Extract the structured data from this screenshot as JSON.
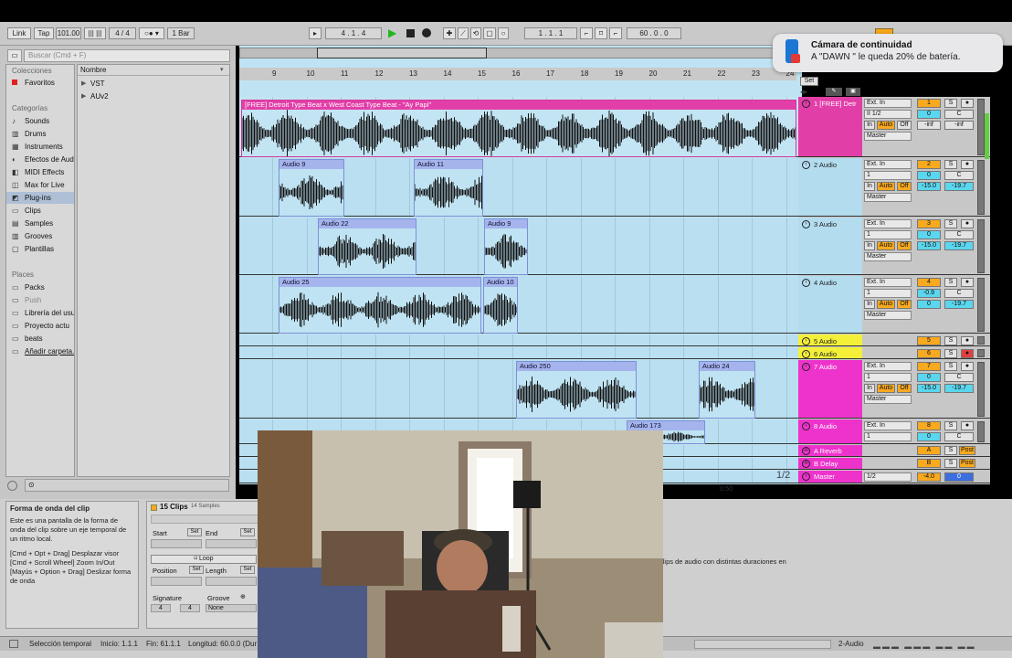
{
  "control_bar": {
    "link": "Link",
    "tap": "Tap",
    "tempo": "101.00",
    "signature": "4 / 4",
    "quantize": "1 Bar",
    "arrangement_position": "4 . 1 . 4",
    "punch_position": "1 . 1 . 1",
    "loop_length": "60 . 0 . 0"
  },
  "browser": {
    "search_placeholder": "Buscar (Cmd + F)",
    "collections_header": "Colecciones",
    "favorites": "Favoritos",
    "categories_header": "Categorías",
    "categories": [
      "Sounds",
      "Drums",
      "Instruments",
      "Efectos de Aud",
      "MIDI Effects",
      "Max for Live",
      "Plug-ins",
      "Clips",
      "Samples",
      "Grooves",
      "Plantillas"
    ],
    "selected_category": "Plug-ins",
    "places_header": "Places",
    "places": [
      "Packs",
      "Push",
      "Librería del usu",
      "Proyecto actu",
      "beats",
      "Añadir carpeta..."
    ],
    "column_header": "Nombre",
    "files": [
      "VST",
      "AUv2"
    ]
  },
  "ruler": {
    "bars": [
      "9",
      "10",
      "11",
      "12",
      "13",
      "14",
      "15",
      "16",
      "17",
      "18",
      "19",
      "20",
      "21",
      "22",
      "23",
      "24"
    ],
    "set_label": "Set"
  },
  "clips": {
    "track1": "[FREE] Detroit Type Beat x West Coast Type Beat - \"Ay Papi\"",
    "audio9a": "Audio 9",
    "audio11": "Audio 11",
    "audio22": "Audio 22",
    "audio9b": "Audio 9",
    "audio25": "Audio 25",
    "audio10": "Audio 10",
    "audio250": "Audio 250",
    "audio24": "Audio 24",
    "audio173": "Audio 173"
  },
  "tracks": [
    {
      "name": "1 [FREE] Detr",
      "input": "Ext. In",
      "channel": "II 1/2",
      "out": "Master",
      "number": "1",
      "vol": "0",
      "pan": "C",
      "peak1": "-inf",
      "peak2": "-inf"
    },
    {
      "name": "2 Audio",
      "input": "Ext. In",
      "channel": "1",
      "out": "Master",
      "number": "2",
      "vol": "0",
      "pan": "C",
      "peak1": "-15.0",
      "peak2": "-19.7"
    },
    {
      "name": "3 Audio",
      "input": "Ext. In",
      "channel": "1",
      "out": "Master",
      "number": "3",
      "vol": "0",
      "pan": "C",
      "peak1": "-15.0",
      "peak2": "-19.7"
    },
    {
      "name": "4 Audio",
      "input": "Ext. In",
      "channel": "1",
      "out": "Master",
      "number": "4",
      "vol": "-0.9",
      "pan": "C",
      "peak1": "0",
      "peak2": "-19.7"
    },
    {
      "name": "5 Audio",
      "number": "5"
    },
    {
      "name": "6 Audio",
      "number": "6"
    },
    {
      "name": "7 Audio",
      "input": "Ext. In",
      "channel": "1",
      "out": "Master",
      "number": "7",
      "vol": "0",
      "pan": "C",
      "peak1": "-15.0",
      "peak2": "-19.7"
    },
    {
      "name": "8 Audio",
      "input": "Ext. In",
      "channel": "1",
      "number": "8",
      "vol": "0",
      "pan": "C"
    }
  ],
  "returns": {
    "a_name": "A Reverb",
    "a_letter": "A",
    "b_name": "B Delay",
    "b_letter": "B",
    "master_name": "Master",
    "master_channel": "1/2",
    "master_vol": "-4.0",
    "master_pan": "0",
    "post": "Post",
    "page": "1/2",
    "time_marker": "0:50"
  },
  "mixer_labels": {
    "in": "In",
    "auto": "Auto",
    "off": "Off",
    "s": "S"
  },
  "info_pane": {
    "title": "Forma de onda del clip",
    "text1": "Este es una pantalla de la forma de onda del clip sobre un eje temporal de un ritmo local.",
    "text2": "[Cmd + Opt + Drag] Desplazar visor",
    "text3": "[Cmd + Scroll Wheel] Zoom In/Out",
    "text4": "[Mayús + Option + Drag] Deslizar forma de onda"
  },
  "clip_pane": {
    "title": "15 Clips",
    "subtitle": "14 Samples",
    "start": "Start",
    "end": "End",
    "set": "Set",
    "loop": "Loop",
    "position": "Position",
    "length": "Length",
    "signature": "Signature",
    "groove": "Groove",
    "sig_num": "4",
    "sig_den": "4",
    "groove_value": "None"
  },
  "detail_text": "clips de audio con distintas duraciones en",
  "status": {
    "selection": "Selección temporal",
    "start": "Inicio: 1.1.1",
    "end": "Fin: 61.1.1",
    "length": "Longitud: 60.0.0 (Dur",
    "track": "2-Audio"
  },
  "notification": {
    "title": "Cámara de continuidad",
    "body": "A \"DAWN \" le queda 20% de batería."
  },
  "colors": {
    "track_pink": "#e23ea8",
    "track_magenta": "#ee33cc",
    "track_blue": "#b3dcee",
    "track_yellow": "#f4f03a",
    "meter_orange": "#f7a91f"
  }
}
